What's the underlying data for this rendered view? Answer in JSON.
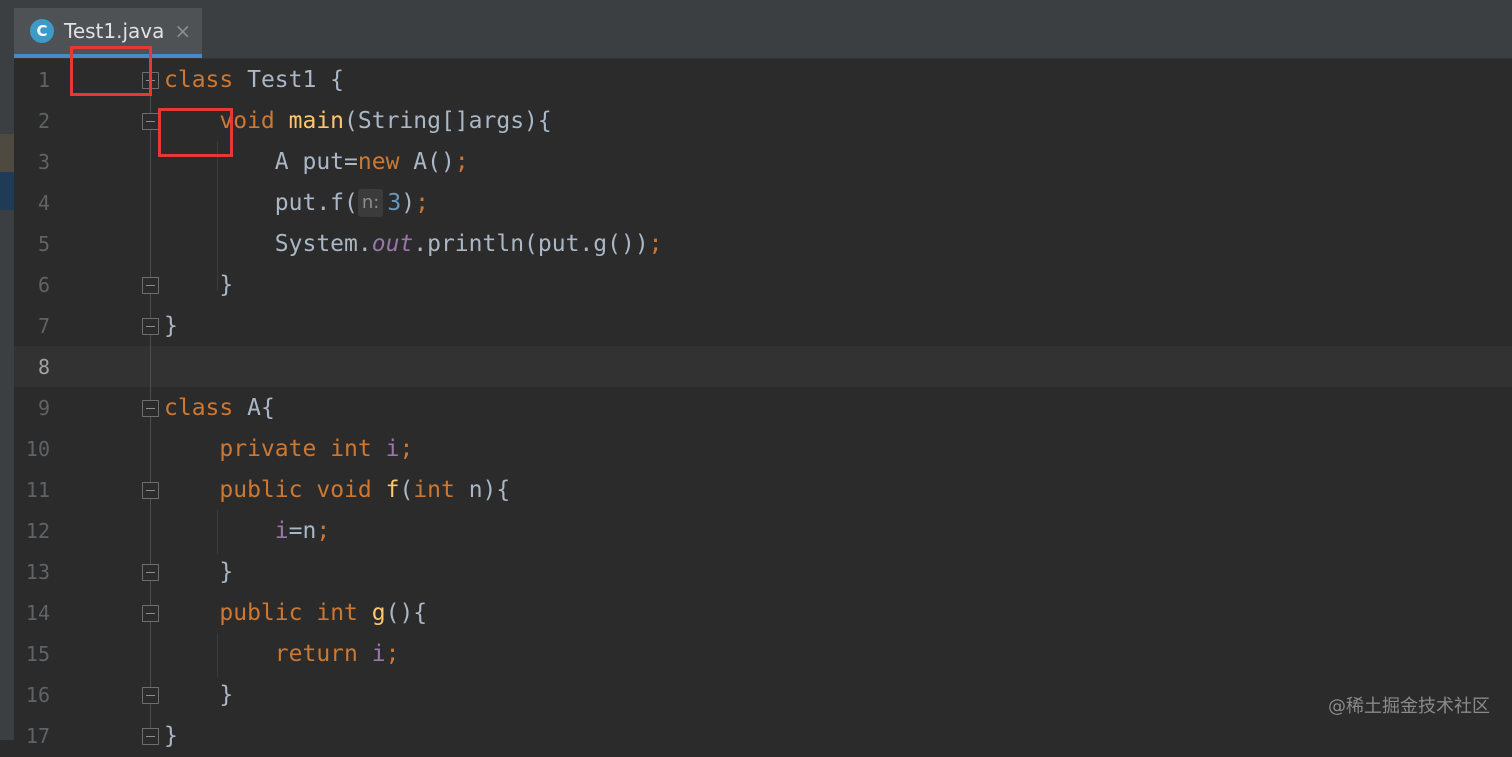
{
  "tab": {
    "icon_letter": "C",
    "title": "Test1.java",
    "close": "×"
  },
  "lines": [
    {
      "n": "1",
      "code": [
        "class",
        " Test1 {"
      ]
    },
    {
      "n": "2",
      "code": [
        "void",
        "main",
        "(String[]args){"
      ]
    },
    {
      "n": "3",
      "code": [
        "A put=",
        "new",
        " A()",
        ";"
      ]
    },
    {
      "n": "4",
      "code": [
        "put.f(",
        "n:",
        "3",
        ")",
        ";"
      ]
    },
    {
      "n": "5",
      "code": [
        "System.",
        "out",
        ".println(put.g())",
        ";"
      ]
    },
    {
      "n": "6",
      "code": [
        "}"
      ]
    },
    {
      "n": "7",
      "code": [
        "}"
      ]
    },
    {
      "n": "8",
      "code": []
    },
    {
      "n": "9",
      "code": [
        "class",
        " A{"
      ]
    },
    {
      "n": "10",
      "code": [
        "private",
        "int",
        "i",
        ";"
      ]
    },
    {
      "n": "11",
      "code": [
        "public",
        "void",
        "f",
        "(",
        "int",
        " n){"
      ]
    },
    {
      "n": "12",
      "code": [
        "i",
        "=n",
        ";"
      ]
    },
    {
      "n": "13",
      "code": [
        "}"
      ]
    },
    {
      "n": "14",
      "code": [
        "public",
        "int",
        "g",
        "(){"
      ]
    },
    {
      "n": "15",
      "code": [
        "return",
        "i",
        ";"
      ]
    },
    {
      "n": "16",
      "code": [
        "}"
      ]
    },
    {
      "n": "17",
      "code": [
        "}"
      ]
    }
  ],
  "colors": {
    "keyword": "#cc7832",
    "function": "#ffc66d",
    "field": "#9876aa",
    "number": "#6897bb",
    "default_text": "#a9b7c6",
    "annotation_box": "#e53935"
  },
  "watermark": "@稀土掘金技术社区"
}
